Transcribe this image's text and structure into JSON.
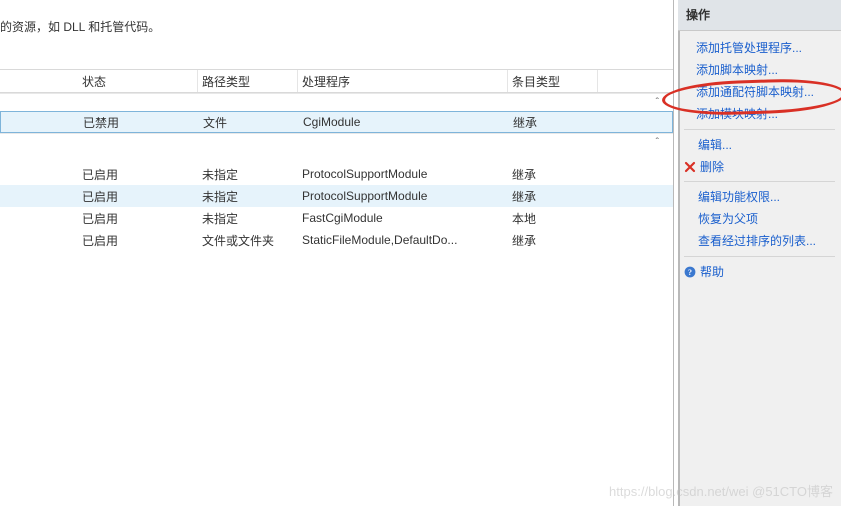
{
  "description": "的资源，如 DLL 和托管代码。",
  "columns": {
    "state": "状态",
    "path": "路径类型",
    "handler": "处理程序",
    "entry": "条目类型"
  },
  "rows": {
    "disabled": [
      {
        "state": "已禁用",
        "path": "文件",
        "handler": "CgiModule",
        "entry": "继承"
      }
    ],
    "enabled": [
      {
        "state": "已启用",
        "path": "未指定",
        "handler": "ProtocolSupportModule",
        "entry": "继承"
      },
      {
        "state": "已启用",
        "path": "未指定",
        "handler": "ProtocolSupportModule",
        "entry": "继承"
      },
      {
        "state": "已启用",
        "path": "未指定",
        "handler": "FastCgiModule",
        "entry": "本地"
      },
      {
        "state": "已启用",
        "path": "文件或文件夹",
        "handler": "StaticFileModule,DefaultDo...",
        "entry": "继承"
      }
    ]
  },
  "actions": {
    "title": "操作",
    "add_managed": "添加托管处理程序...",
    "add_script": "添加脚本映射...",
    "add_wildcard": "添加通配符脚本映射...",
    "add_module": "添加模块映射...",
    "edit": "编辑...",
    "delete": "删除",
    "edit_perms": "编辑功能权限...",
    "revert": "恢复为父项",
    "view_ordered": "查看经过排序的列表...",
    "help": "帮助"
  },
  "chevron": "ˆ",
  "watermark": "https://blog.csdn.net/wei @51CTO博客"
}
